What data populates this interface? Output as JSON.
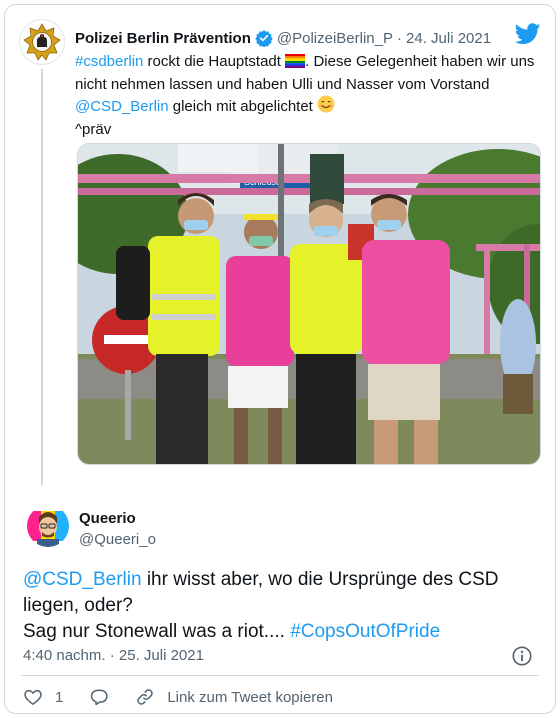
{
  "quoted_tweet": {
    "author_name": "Polizei Berlin Prävention",
    "handle": "@PolizeiBerlin_P",
    "separator": "·",
    "date": "24. Juli 2021",
    "text": {
      "hashtag": "#csdberlin",
      "part1": " rockt die Hauptstadt ",
      "flag_emoji": "🏳️‍🌈",
      "part2": ". Diese Gelegenheit haben wir uns nicht nehmen lassen und haben Ulli und Nasser vom Vorstand ",
      "mention": "@CSD_Berlin",
      "part3": " gleich mit abgelichtet ",
      "smile_emoji": "😊",
      "signature": "^präv"
    },
    "photo_sign_text": "Schleuse"
  },
  "main_tweet": {
    "author_name": "Queerio",
    "handle": "@Queeri_o",
    "text": {
      "mention": "@CSD_Berlin",
      "part1": " ihr wisst aber, wo die Ursprünge des CSD liegen, oder?",
      "part2": "Sag nur Stonewall was a riot.... ",
      "hashtag": "#CopsOutOfPride"
    },
    "timestamp": "4:40 nachm. · 25. Juli 2021",
    "like_count": "1",
    "copy_link_label": "Link zum Tweet kopieren"
  },
  "colors": {
    "link": "#1d9bf0",
    "secondary_text": "#536471",
    "border": "#cfd9de",
    "verified": "#1d9bf0",
    "police_badge_gold": "#d4a017"
  },
  "icons": {
    "twitter_logo": "twitter-bird-icon",
    "verified": "verified-badge-icon",
    "info": "info-icon",
    "like": "heart-icon",
    "reply": "reply-bubble-icon",
    "share": "link-icon"
  }
}
